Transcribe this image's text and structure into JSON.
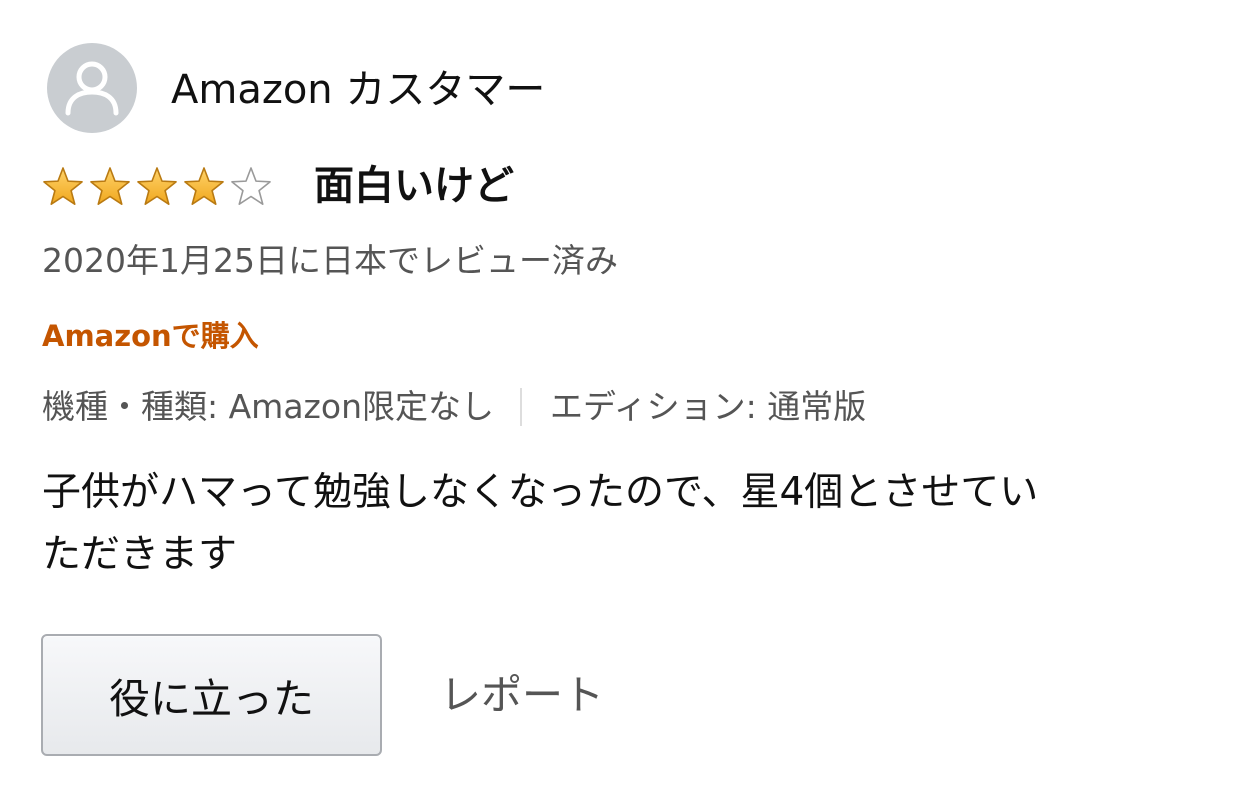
{
  "reviewer": {
    "name": "Amazon カスタマー",
    "avatar_icon": "default-user-avatar-icon"
  },
  "rating": {
    "value": 4,
    "max": 5,
    "filled_color": "#f0a71e",
    "empty_color": "#ffffff"
  },
  "review": {
    "title": "面白いけど",
    "date": "2020年1月25日に日本でレビュー済み",
    "verified_label": "Amazonで購入",
    "variant": {
      "model": "機種・種類: Amazon限定なし",
      "edition": "エディション: 通常版"
    },
    "body_lines": [
      "子供がハマって勉強しなくなったので、星4個とさせてい",
      "ただきます"
    ]
  },
  "actions": {
    "helpful_label": "役に立った",
    "report_label": "レポート"
  },
  "colors": {
    "verified": "#c45500",
    "secondary_text": "#555555"
  }
}
